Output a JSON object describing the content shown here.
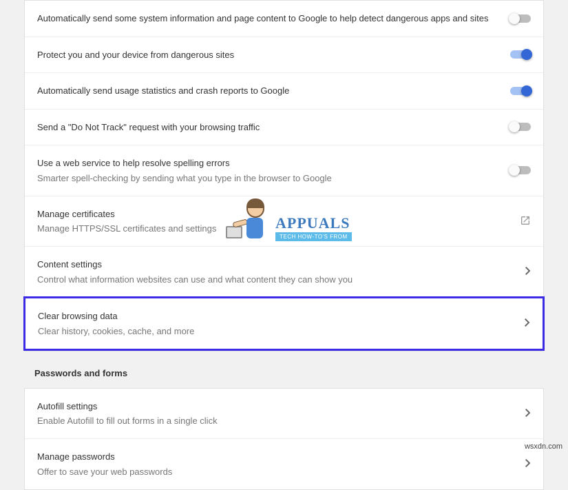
{
  "privacy": [
    {
      "key": "sysinfo",
      "title": "Automatically send some system information and page content to Google to help detect dangerous apps and sites",
      "subtitle": null,
      "control": "toggle",
      "state": "off"
    },
    {
      "key": "protect",
      "title": "Protect you and your device from dangerous sites",
      "subtitle": null,
      "control": "toggle",
      "state": "on"
    },
    {
      "key": "usage",
      "title": "Automatically send usage statistics and crash reports to Google",
      "subtitle": null,
      "control": "toggle",
      "state": "on"
    },
    {
      "key": "dnt",
      "title": "Send a \"Do Not Track\" request with your browsing traffic",
      "subtitle": null,
      "control": "toggle",
      "state": "off"
    },
    {
      "key": "spell",
      "title": "Use a web service to help resolve spelling errors",
      "subtitle": "Smarter spell-checking by sending what you type in the browser to Google",
      "control": "toggle",
      "state": "off"
    },
    {
      "key": "certs",
      "title": "Manage certificates",
      "subtitle": "Manage HTTPS/SSL certificates and settings",
      "control": "external"
    },
    {
      "key": "content",
      "title": "Content settings",
      "subtitle": "Control what information websites can use and what content they can show you",
      "control": "arrow"
    },
    {
      "key": "clear",
      "title": "Clear browsing data",
      "subtitle": "Clear history, cookies, cache, and more",
      "control": "arrow",
      "highlight": true
    }
  ],
  "passwords_header": "Passwords and forms",
  "passwords": [
    {
      "key": "autofill",
      "title": "Autofill settings",
      "subtitle": "Enable Autofill to fill out forms in a single click",
      "control": "arrow"
    },
    {
      "key": "managepw",
      "title": "Manage passwords",
      "subtitle": "Offer to save your web passwords",
      "control": "arrow"
    }
  ],
  "watermark": "wsxdn.com",
  "logo": {
    "title": "APPUALS",
    "sub": "TECH HOW-TO'S FROM"
  }
}
